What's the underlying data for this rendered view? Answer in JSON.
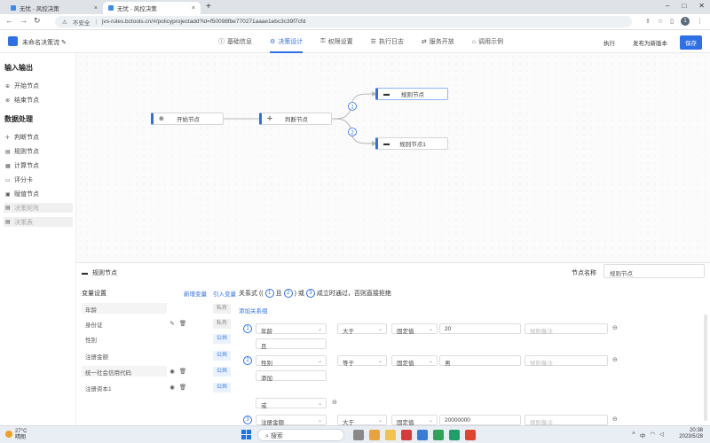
{
  "browser": {
    "tabs": [
      {
        "title": "无忧 - 风控决策",
        "active": false
      },
      {
        "title": "无忧 - 风控决策",
        "active": true
      }
    ],
    "security_label": "不安全",
    "url": "jvs-rules.bctools.cn/#/policyprojectadd?id=f50098fbe770271aaae1ebc3c39f7cfd",
    "profile_initial": "1"
  },
  "app": {
    "project_name": "未命名决策流",
    "nav_tabs": [
      {
        "label": "基础信息",
        "icon": "ⓘ",
        "active": false
      },
      {
        "label": "决策设计",
        "icon": "⚙",
        "active": true
      },
      {
        "label": "权限设置",
        "icon": "⚿",
        "active": false
      },
      {
        "label": "执行日志",
        "icon": "☰",
        "active": false
      },
      {
        "label": "服务开放",
        "icon": "⇄",
        "active": false
      },
      {
        "label": "调用示例",
        "icon": "⌂",
        "active": false
      }
    ],
    "actions": {
      "run": "执行",
      "publish": "发布为新版本",
      "save": "保存"
    },
    "accent_color": "#2f6fe8"
  },
  "sidebar": {
    "section_io": "输入输出",
    "io_items": [
      {
        "label": "开始节点",
        "icon": "⊕"
      },
      {
        "label": "结束节点",
        "icon": "⊗"
      }
    ],
    "section_data": "数据处理",
    "data_items": [
      {
        "label": "判断节点",
        "icon": "✛",
        "disabled": false
      },
      {
        "label": "规则节点",
        "icon": "▤",
        "disabled": false
      },
      {
        "label": "计算节点",
        "icon": "▦",
        "disabled": false
      },
      {
        "label": "评分卡",
        "icon": "▭",
        "disabled": false
      },
      {
        "label": "赋值节点",
        "icon": "▣",
        "disabled": false
      },
      {
        "label": "决策矩阵",
        "icon": "▤",
        "disabled": true
      },
      {
        "label": "决策表",
        "icon": "▤",
        "disabled": true
      }
    ]
  },
  "canvas": {
    "nodes": [
      {
        "id": "start",
        "label": "开始节点",
        "icon": "⊕"
      },
      {
        "id": "judge",
        "label": "判断节点",
        "icon": "✛"
      },
      {
        "id": "rule",
        "label": "规则节点",
        "icon": "▬"
      },
      {
        "id": "rule1",
        "label": "规则节点1",
        "icon": "▬"
      }
    ],
    "branch_labels": [
      "1",
      "2"
    ]
  },
  "panel": {
    "title": "规则节点",
    "node_name_label": "节点名称",
    "node_name_value": "规则节点",
    "variables_header": "变量设置",
    "add_variable": "新增变量",
    "import_variable": "引入变量",
    "variables": [
      {
        "name": "年龄",
        "tag": "私有",
        "public": false,
        "edit": false,
        "view": false,
        "delete": false
      },
      {
        "name": "身份证",
        "tag": "私有",
        "public": false,
        "edit": true,
        "view": false,
        "delete": true
      },
      {
        "name": "性别",
        "tag": "公共",
        "public": true,
        "edit": false,
        "view": false,
        "delete": false
      },
      {
        "name": "注册金额",
        "tag": "公共",
        "public": true,
        "edit": false,
        "view": false,
        "delete": false
      },
      {
        "name": "统一社会信用代码",
        "tag": "公共",
        "public": true,
        "edit": false,
        "view": true,
        "delete": true
      },
      {
        "name": "注册资本1",
        "tag": "公共",
        "public": true,
        "edit": false,
        "view": true,
        "delete": true
      }
    ],
    "relation": {
      "prefix": "关系式 ((",
      "c1": "1",
      "and": "且",
      "c2": "2",
      "or_text": ") 或",
      "c3": "3",
      "suffix": "成立时通过，否则直接拒绝"
    },
    "add_relation_group": "添加关系组",
    "conditions": [
      {
        "num": "1",
        "field": "年龄",
        "op": "大于",
        "type": "固定值",
        "value": "20",
        "note_placeholder": "规则备注",
        "sub": "且"
      },
      {
        "num": "2",
        "field": "性别",
        "op": "等于",
        "type": "固定值",
        "value": "男",
        "note_placeholder": "规则备注",
        "sub": "添加"
      },
      {
        "num": "3",
        "field": "注册金额",
        "op": "大于",
        "type": "固定值",
        "value": "20000000",
        "note_placeholder": "规则备注"
      }
    ],
    "or_select": "或"
  },
  "taskbar": {
    "weather_temp": "27°C",
    "weather_desc": "晴朗",
    "search_label": "搜索",
    "time": "20:38",
    "date": "2023/5/28"
  }
}
